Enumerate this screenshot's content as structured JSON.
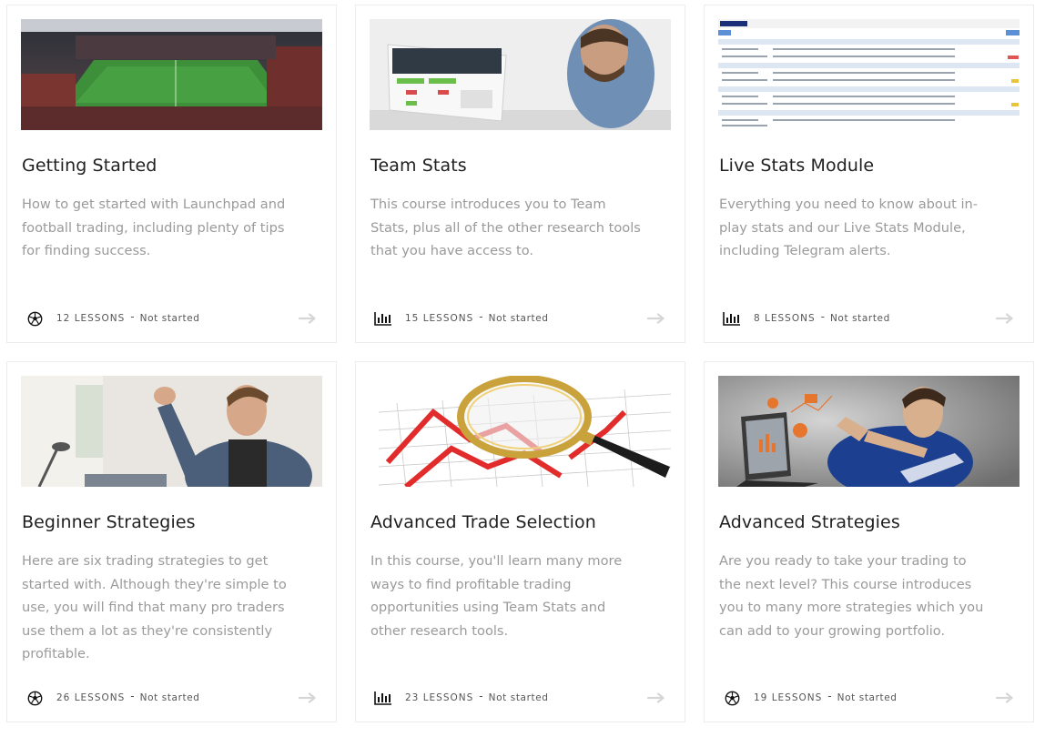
{
  "courses": [
    {
      "title": "Getting Started",
      "description": "How to get started with Launchpad and football trading, including plenty of tips for finding success.",
      "icon": "football-icon",
      "lessons": "12 LESSONS",
      "separator": "-",
      "status": "Not started"
    },
    {
      "title": "Team Stats",
      "description": "This course introduces you to Team Stats, plus all of the other research tools that you have access to.",
      "icon": "bar-chart-icon",
      "lessons": "15 LESSONS",
      "separator": "-",
      "status": "Not started"
    },
    {
      "title": "Live Stats Module",
      "description": "Everything you need to know about in-play stats and our Live Stats Module, including Telegram alerts.",
      "icon": "bar-chart-icon",
      "lessons": "8 LESSONS",
      "separator": "-",
      "status": "Not started"
    },
    {
      "title": "Beginner Strategies",
      "description": "Here are six trading strategies to get started with. Although they're simple to use, you will find that many pro traders use them a lot as they're consistently profitable.",
      "icon": "football-icon",
      "lessons": "26 LESSONS",
      "separator": "-",
      "status": "Not started"
    },
    {
      "title": "Advanced Trade Selection",
      "description": "In this course, you'll learn many more ways to find profitable trading opportunities using Team Stats and other research tools.",
      "icon": "bar-chart-icon",
      "lessons": "23 LESSONS",
      "separator": "-",
      "status": "Not started"
    },
    {
      "title": "Advanced Strategies",
      "description": "Are you ready to take your trading to the next level? This course introduces you to many more strategies which you can add to your growing portfolio.",
      "icon": "football-icon",
      "lessons": "19 LESSONS",
      "separator": "-",
      "status": "Not started"
    }
  ],
  "colors": {
    "title": "#1f1f1f",
    "description": "#9a9a9a",
    "meta": "#555555",
    "arrow": "#d6d6d6",
    "border": "#ececec"
  }
}
